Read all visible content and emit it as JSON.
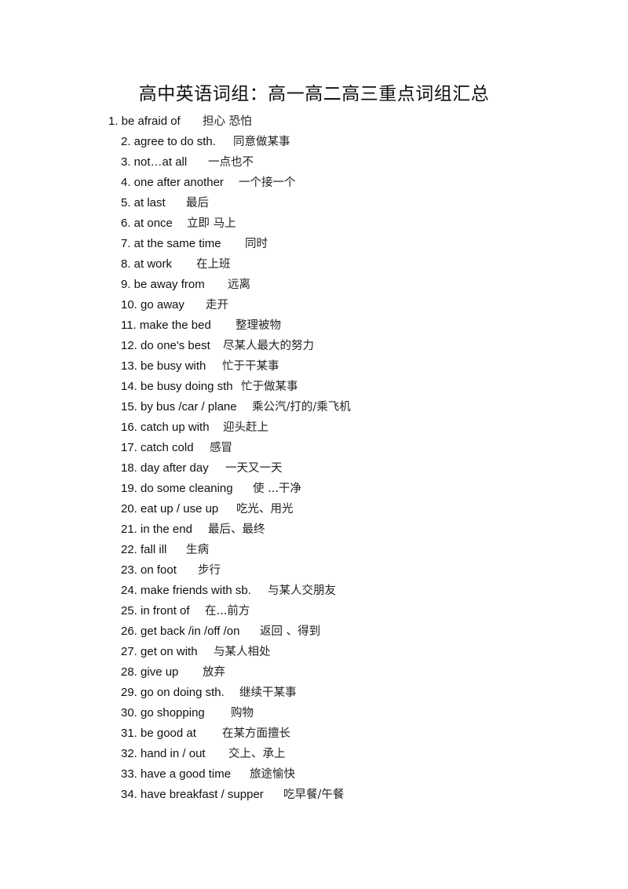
{
  "document": {
    "title": "高中英语词组：高一高二高三重点词组汇总",
    "entries": [
      {
        "en": "1. be afraid of",
        "zh": "担心  恐怕"
      },
      {
        "en": "2. agree to do sth.",
        "zh": "同意做某事"
      },
      {
        "en": "3. not…at all",
        "zh": "一点也不"
      },
      {
        "en": "4. one after another",
        "zh": "一个接一个"
      },
      {
        "en": "5. at last",
        "zh": "最后"
      },
      {
        "en": "6. at once",
        "zh": "立即   马上"
      },
      {
        "en": "7. at the same time",
        "zh": "同时"
      },
      {
        "en": "8. at work",
        "zh": "在上班"
      },
      {
        "en": "9. be away from",
        "zh": "远离"
      },
      {
        "en": "10. go away",
        "zh": "走开"
      },
      {
        "en": "11. make the bed",
        "zh": "整理被物"
      },
      {
        "en": "12. do one's best",
        "zh": "尽某人最大的努力"
      },
      {
        "en": "13. be busy with",
        "zh": "忙于干某事"
      },
      {
        "en": "14. be busy doing sth",
        "zh": "忙于做某事"
      },
      {
        "en": "15. by bus /car / plane",
        "zh": "乘公汽/打的/乘飞机"
      },
      {
        "en": "16. catch up with",
        "zh": "迎头赶上"
      },
      {
        "en": "17. catch cold",
        "zh": "感冒"
      },
      {
        "en": "18. day after day",
        "zh": "一天又一天"
      },
      {
        "en": "19. do some cleaning",
        "zh": "使  ...干净"
      },
      {
        "en": "20. eat up / use up",
        "zh": "吃光、用光"
      },
      {
        "en": "21. in the end",
        "zh": "最后、最终"
      },
      {
        "en": "22. fall ill",
        "zh": "生病"
      },
      {
        "en": "23. on foot",
        "zh": "步行"
      },
      {
        "en": "24. make friends with sb.",
        "zh": "与某人交朋友"
      },
      {
        "en": "25. in front of",
        "zh": "在...前方"
      },
      {
        "en": "26. get back /in /off /on",
        "zh": "返回  、得到"
      },
      {
        "en": "27. get on with",
        "zh": "与某人相处"
      },
      {
        "en": "28. give up",
        "zh": "放弃"
      },
      {
        "en": "29. go on doing sth.",
        "zh": "继续干某事"
      },
      {
        "en": "30. go shopping",
        "zh": "购物"
      },
      {
        "en": "31. be good at",
        "zh": "在某方面擅长"
      },
      {
        "en": "32. hand in / out",
        "zh": "交上、承上"
      },
      {
        "en": "33. have a good time",
        "zh": "旅途愉快"
      },
      {
        "en": "34. have breakfast / supper",
        "zh": "吃早餐/午餐"
      }
    ]
  }
}
